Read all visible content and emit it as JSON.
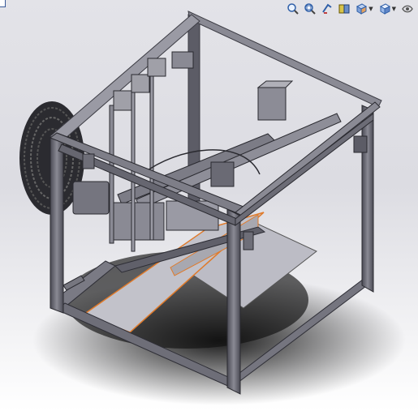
{
  "window": {
    "title": ""
  },
  "toolbar": {
    "items": [
      {
        "icon": "zoom-to-fit-icon"
      },
      {
        "icon": "zoom-to-area-icon"
      },
      {
        "icon": "previous-view-icon"
      },
      {
        "icon": "section-view-icon"
      },
      {
        "icon": "view-orientation-icon",
        "dropdown": true
      },
      {
        "icon": "display-style-icon",
        "dropdown": true
      },
      {
        "icon": "hide-show-items-icon"
      }
    ]
  },
  "model": {
    "description_colors": {
      "frame": "#6e6e78",
      "frame_dark": "#3c3c44",
      "bed_plate": "#b7b7c0",
      "selection_edge": "#e07a2a"
    }
  }
}
